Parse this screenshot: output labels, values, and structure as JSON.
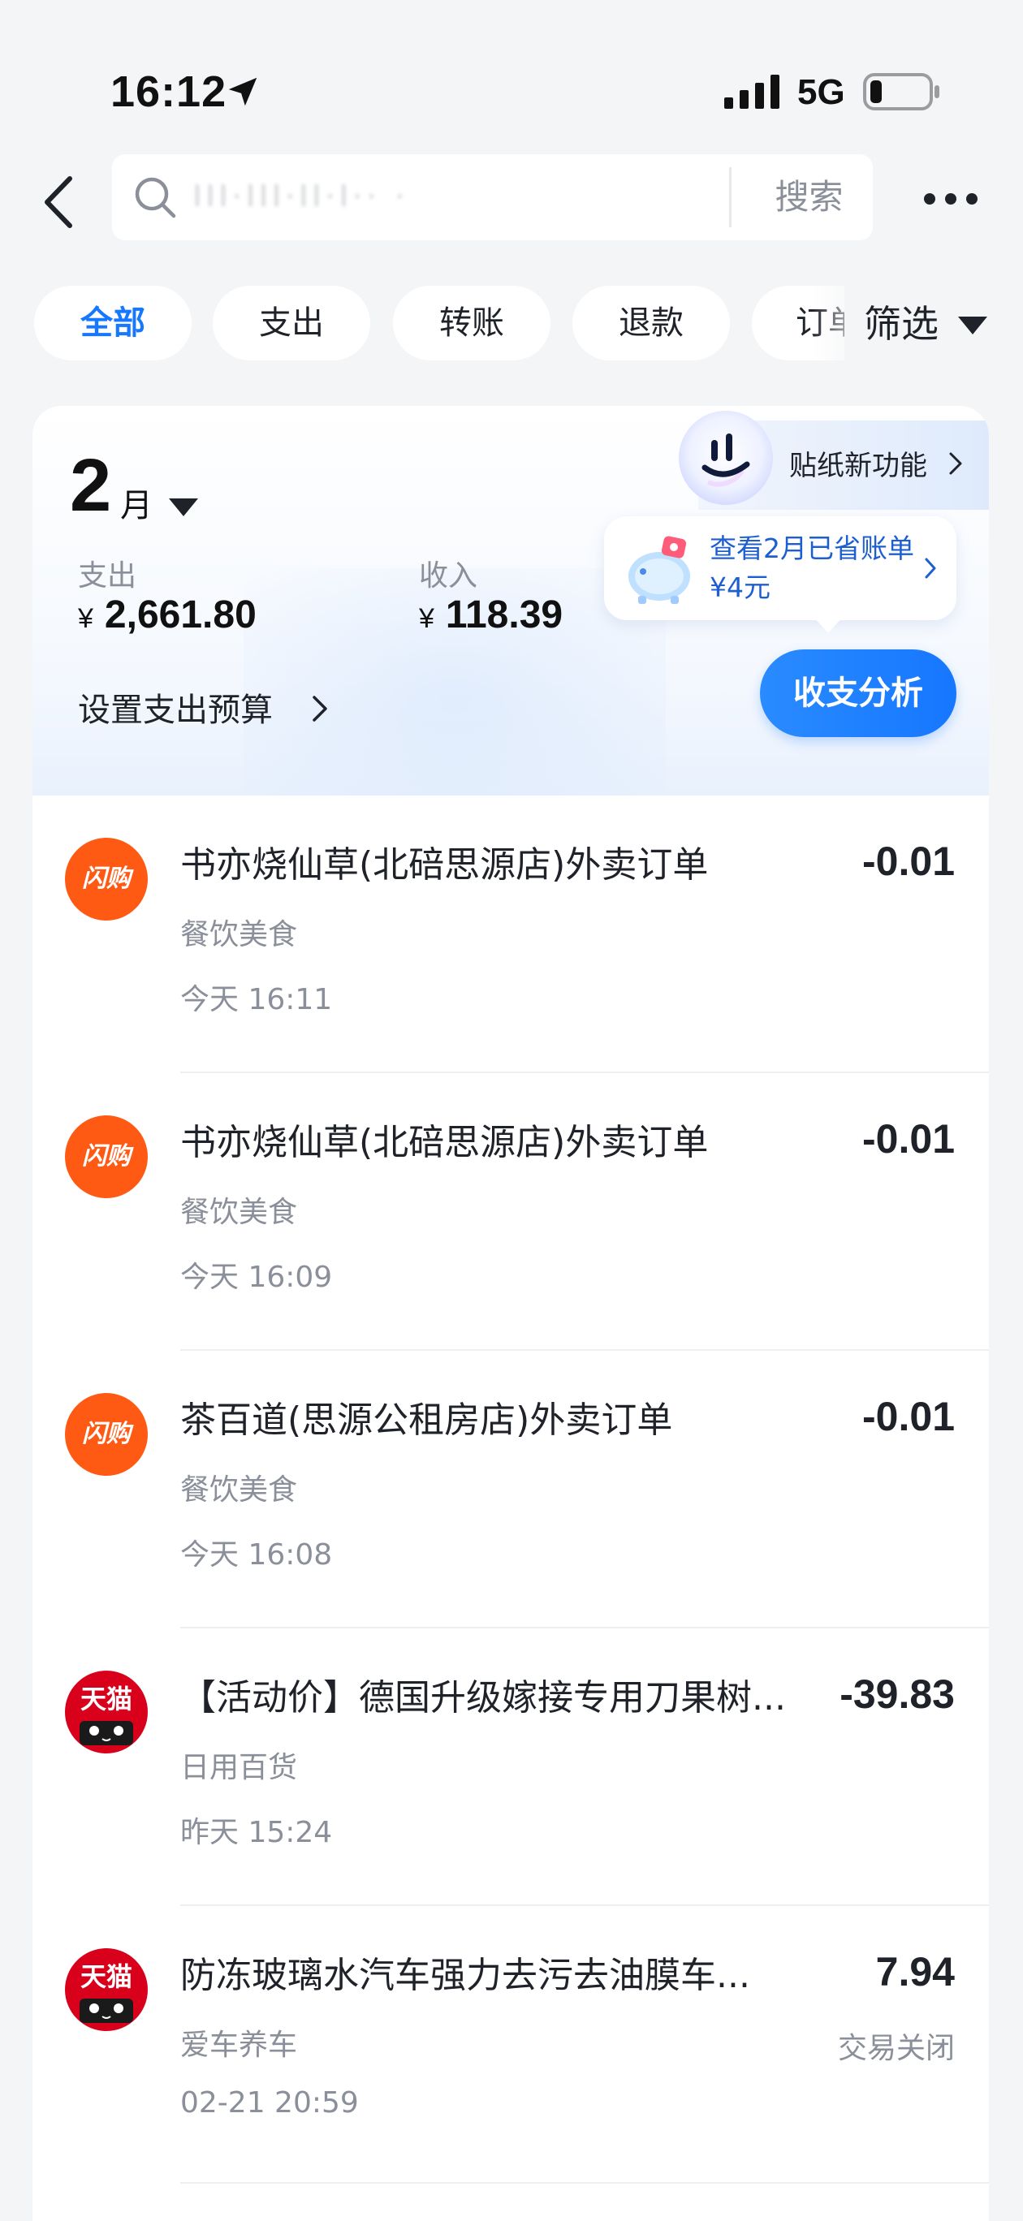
{
  "status_bar": {
    "time": "16:12",
    "network": "5G"
  },
  "header": {
    "search_placeholder": "lll·lll·ll·l·· ·",
    "search_button": "搜索"
  },
  "filters": {
    "chips": [
      "全部",
      "支出",
      "转账",
      "退款",
      "订单"
    ],
    "active_index": 0,
    "filter_label": "筛选"
  },
  "summary": {
    "month_number": "2",
    "month_unit": "月",
    "sticker_label": "贴纸新功能",
    "expense_label": "支出",
    "expense_currency": "¥",
    "expense_amount": "2,661.80",
    "income_label": "收入",
    "income_currency": "¥",
    "income_amount": "118.39",
    "savings_text": "查看2月已省账单¥4元",
    "budget_link": "设置支出预算",
    "analysis_button": "收支分析"
  },
  "transactions": [
    {
      "logo": "闪购",
      "title": "书亦烧仙草(北碚思源店)外卖订单",
      "category": "餐饮美食",
      "time": "今天 16:11",
      "amount": "-0.01",
      "status": ""
    },
    {
      "logo": "闪购",
      "title": "书亦烧仙草(北碚思源店)外卖订单",
      "category": "餐饮美食",
      "time": "今天 16:09",
      "amount": "-0.01",
      "status": ""
    },
    {
      "logo": "闪购",
      "title": "茶百道(思源公租房店)外卖订单",
      "category": "餐饮美食",
      "time": "今天 16:08",
      "amount": "-0.01",
      "status": ""
    },
    {
      "logo": "天猫",
      "title": "【活动价】德国升级嫁接专用刀果树...",
      "category": "日用百货",
      "time": "昨天 15:24",
      "amount": "-39.83",
      "status": ""
    },
    {
      "logo": "天猫",
      "title": "防冻玻璃水汽车强力去污去油膜车...",
      "category": "爱车养车",
      "time": "02-21 20:59",
      "amount": "7.94",
      "status": "交易关闭"
    }
  ],
  "colors": {
    "accent": "#1677ff",
    "shangou_logo": "#ff5a14",
    "tmall_logo": "#d9001b",
    "page_background": "#f4f5f7"
  },
  "icons": {
    "back": "chevron-left-icon",
    "search": "search-icon",
    "more": "more-dots-icon",
    "filter_caret": "caret-down-icon",
    "location": "location-arrow-icon",
    "signal": "signal-bars-icon",
    "battery": "battery-icon"
  }
}
